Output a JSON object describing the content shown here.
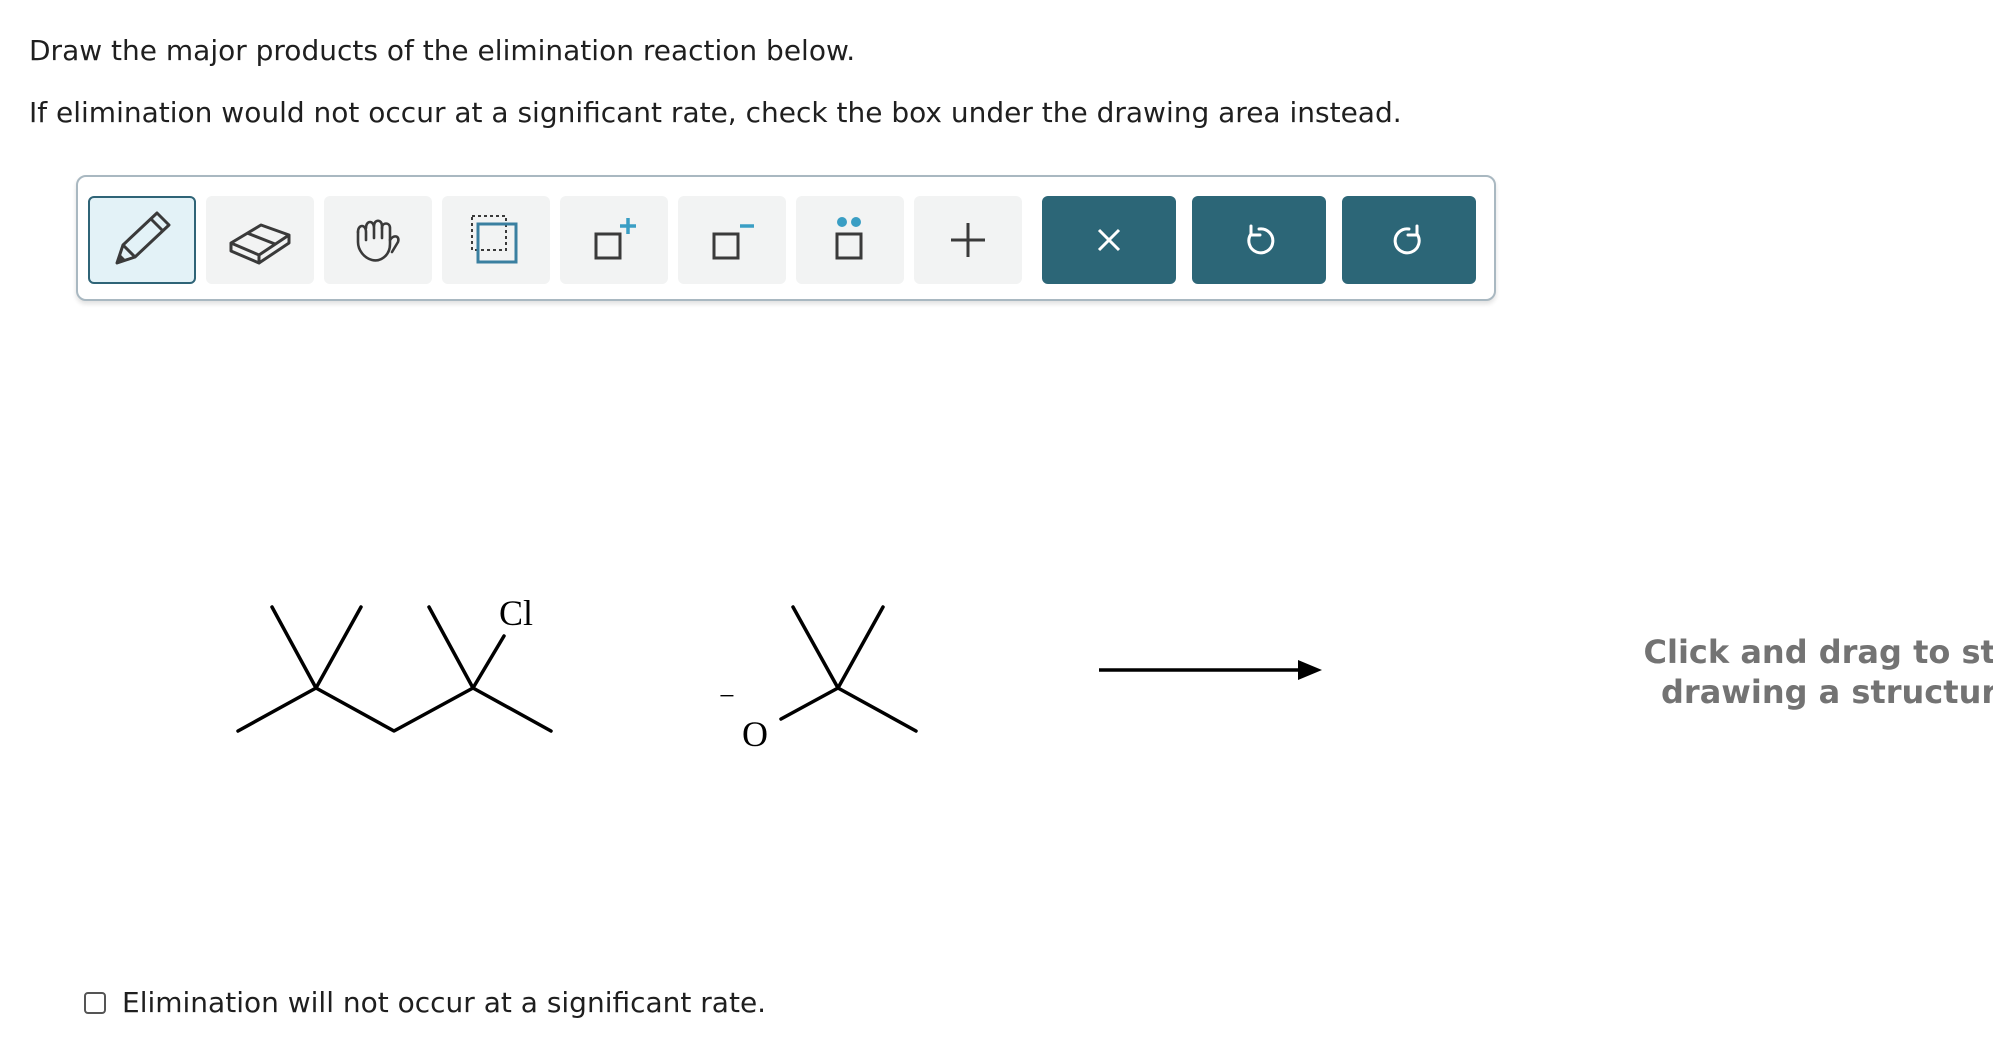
{
  "prompt": {
    "line1": "Draw the major products of the elimination reaction below.",
    "line2": "If elimination would not occur at a significant rate, check the box under the drawing area instead."
  },
  "toolbar": {
    "tools": [
      {
        "name": "pencil-icon",
        "active": true
      },
      {
        "name": "eraser-icon"
      },
      {
        "name": "hand-icon"
      },
      {
        "name": "select-box-icon"
      },
      {
        "name": "positive-charge-icon",
        "glyph": "+"
      },
      {
        "name": "negative-charge-icon",
        "glyph": "−"
      },
      {
        "name": "lone-pair-icon"
      },
      {
        "name": "plus-icon"
      }
    ],
    "actions": [
      {
        "name": "clear-icon"
      },
      {
        "name": "undo-icon"
      },
      {
        "name": "redo-icon"
      }
    ],
    "accent_color": "#2c6677"
  },
  "reaction": {
    "substrate_label": "Cl",
    "base_atom_label": "O",
    "base_charge": "−"
  },
  "canvas": {
    "hint": "Click and drag to start drawing a structure."
  },
  "no_reaction_checkbox": {
    "label": "Elimination will not occur at a significant rate.",
    "checked": false
  }
}
